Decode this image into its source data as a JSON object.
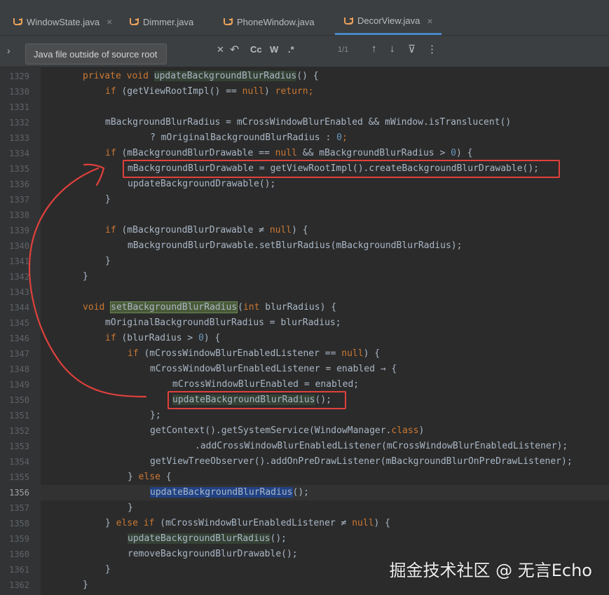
{
  "tabs": [
    {
      "label": "WindowState.java",
      "close": "×",
      "active": false
    },
    {
      "label": "Dimmer.java",
      "active": false
    },
    {
      "label": "PhoneWindow.java",
      "active": false
    },
    {
      "label": "DecorView.java",
      "close": "×",
      "active": true
    }
  ],
  "searchbar": {
    "expand": "›",
    "tooltip": "Java file outside of source root",
    "clear": "✕",
    "undo": "↶",
    "match_case": "Cc",
    "words": "W",
    "regex": ".*",
    "count": "1/1",
    "prev": "↑",
    "next": "↓",
    "filter": "⊽",
    "more": "⋮"
  },
  "gutter": {
    "numbers": [
      "1329",
      "1330",
      "1331",
      "1332",
      "1333",
      "1334",
      "1335",
      "1336",
      "1337",
      "1338",
      "1339",
      "1340",
      "1341",
      "1342",
      "1343",
      "1344",
      "1345",
      "1346",
      "1347",
      "1348",
      "1349",
      "1350",
      "1351",
      "1352",
      "1353",
      "1354",
      "1355",
      "1356",
      "1357",
      "1358",
      "1359",
      "1360",
      "1361",
      "1362"
    ],
    "current_line": "1356"
  },
  "code": {
    "l1329": [
      "private void ",
      "updateBackgroundBlurRadius",
      "() {"
    ],
    "l1330": [
      "if ",
      "(getViewRootImpl() == ",
      "null",
      ") ",
      "return;"
    ],
    "l1332": [
      "mBackgroundBlurRadius = mCrossWindowBlurEnabled && mWindow.isTranslucent()"
    ],
    "l1333": [
      "? mOriginalBackgroundBlurRadius : ",
      "0",
      ";"
    ],
    "l1334": [
      "if ",
      "(mBackgroundBlurDrawable == ",
      "null",
      " && mBackgroundBlurRadius > ",
      "0",
      ") {"
    ],
    "l1335": [
      "mBackgroundBlurDrawable = getViewRootImpl().createBackgroundBlurDrawable();"
    ],
    "l1336": [
      "updateBackgroundDrawable();"
    ],
    "l1337": [
      "}"
    ],
    "l1339": [
      "if ",
      "(mBackgroundBlurDrawable ≠ ",
      "null",
      ") {"
    ],
    "l1340": [
      "mBackgroundBlurDrawable.setBlurRadius(mBackgroundBlurRadius);"
    ],
    "l1341": [
      "}"
    ],
    "l1342": [
      "}"
    ],
    "l1344": [
      "void ",
      "setBackgroundBlurRadius",
      "(",
      "int ",
      "blurRadius) {"
    ],
    "l1345": [
      "mOriginalBackgroundBlurRadius = blurRadius;"
    ],
    "l1346": [
      "if ",
      "(blurRadius > ",
      "0",
      ") {"
    ],
    "l1347": [
      "if ",
      "(mCrossWindowBlurEnabledListener == ",
      "null",
      ") {"
    ],
    "l1348": [
      "mCrossWindowBlurEnabledListener = enabled → {"
    ],
    "l1349": [
      "mCrossWindowBlurEnabled = enabled;"
    ],
    "l1350": [
      "updateBackgroundBlurRadius",
      "();"
    ],
    "l1351": [
      "};"
    ],
    "l1352": [
      "getContext().getSystemService(WindowManager.",
      "class",
      ")"
    ],
    "l1353": [
      ".addCrossWindowBlurEnabledListener(mCrossWindowBlurEnabledListener);"
    ],
    "l1354": [
      "getViewTreeObserver().addOnPreDrawListener(mBackgroundBlurOnPreDrawListener);"
    ],
    "l1355": [
      "} ",
      "else ",
      "{"
    ],
    "l1356": [
      "updateBackgroundBlurRadius",
      "();"
    ],
    "l1357": [
      "}"
    ],
    "l1358": [
      "} ",
      "else if ",
      "(mCrossWindowBlurEnabledListener ≠ ",
      "null",
      ") {"
    ],
    "l1359": [
      "updateBackgroundBlurRadius",
      "();"
    ],
    "l1360": [
      "removeBackgroundBlurDrawable();"
    ],
    "l1361": [
      "}"
    ],
    "l1362": [
      "}"
    ]
  },
  "watermark": "掘金技术社区 @ 无言Echo",
  "colors": {
    "background": "#2b2b2b",
    "keyword": "#cc7832",
    "identifier": "#a9b7c6",
    "number": "#6897bb",
    "field": "#9876aa",
    "annotation_red": "#e0413c",
    "tab_accent": "#4a88c7"
  },
  "icons": [
    "java-file-icon",
    "close-icon",
    "chevron-right-icon",
    "undo-icon",
    "arrow-up-icon",
    "arrow-down-icon",
    "filter-icon",
    "more-icon"
  ]
}
